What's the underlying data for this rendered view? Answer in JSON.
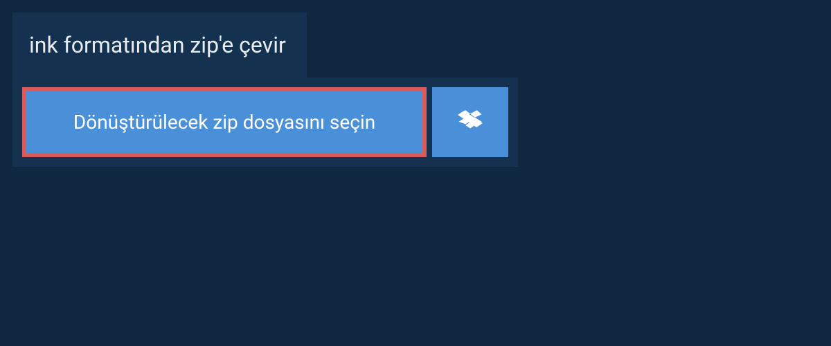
{
  "header": {
    "title": "ink formatından zip'e çevir"
  },
  "upload": {
    "select_file_label": "Dönüştürülecek zip dosyasını seçin"
  },
  "colors": {
    "page_bg": "#0f2840",
    "panel_bg": "#14324f",
    "button_bg": "#4a90d9",
    "button_highlight_border": "#d95b5b",
    "text_light": "#e8edf2",
    "text_white": "#ffffff"
  }
}
